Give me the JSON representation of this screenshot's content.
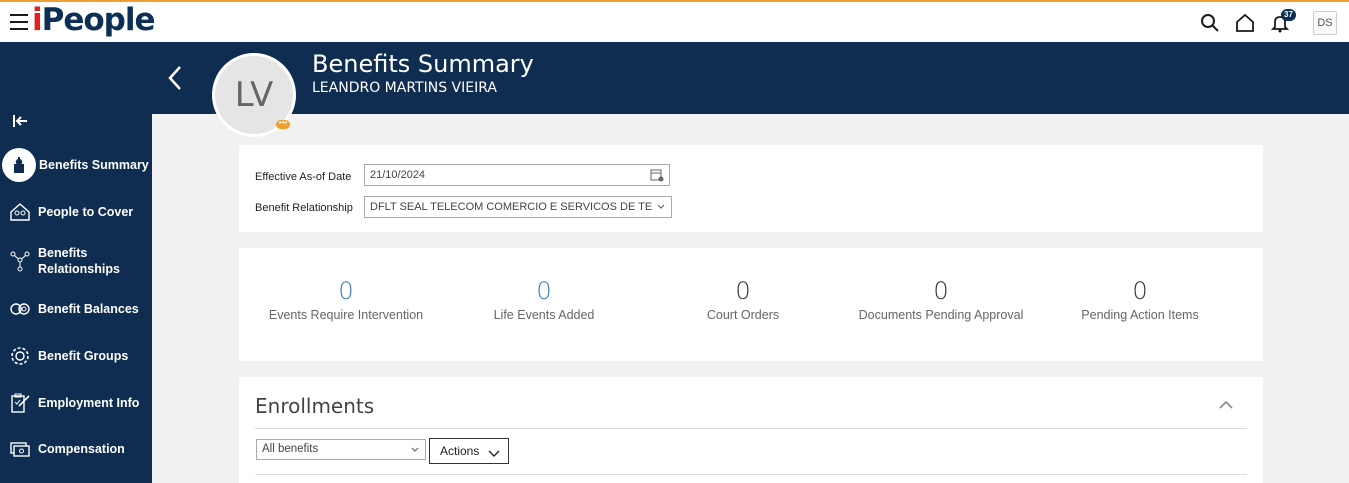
{
  "app": {
    "logo_i": "i",
    "logo_rest": "People",
    "brand_color": "#0b2f55",
    "accent": "#e0201f"
  },
  "topbar": {
    "notifications_count": "37",
    "user_initials": "DS"
  },
  "header": {
    "title": "Benefits Summary",
    "person_name": "LEANDRO MARTINS VIEIRA",
    "avatar_initials": "LV"
  },
  "sidebar": {
    "items": [
      {
        "label": "Benefits Summary",
        "icon": "person-badge-icon"
      },
      {
        "label": "People to Cover",
        "icon": "house-people-icon"
      },
      {
        "label": "Benefits Relationships",
        "icon": "network-icon"
      },
      {
        "label": "Benefit Balances",
        "icon": "balance-icon"
      },
      {
        "label": "Benefit Groups",
        "icon": "gear-group-icon"
      },
      {
        "label": "Employment Info",
        "icon": "clipboard-icon"
      },
      {
        "label": "Compensation",
        "icon": "money-icon"
      }
    ]
  },
  "filters": {
    "date_label": "Effective As-of Date",
    "date_value": "21/10/2024",
    "relationship_label": "Benefit Relationship",
    "relationship_value": "DFLT SEAL TELECOM COMERCIO E SERVICOS DE TELECO"
  },
  "stats": [
    {
      "value": "0",
      "label": "Events Require Intervention"
    },
    {
      "value": "0",
      "label": "Life Events Added"
    },
    {
      "value": "0",
      "label": "Court Orders"
    },
    {
      "value": "0",
      "label": "Documents Pending Approval"
    },
    {
      "value": "0",
      "label": "Pending Action Items"
    }
  ],
  "enrollments": {
    "title": "Enrollments",
    "filter_value": "All benefits",
    "actions_label": "Actions"
  }
}
